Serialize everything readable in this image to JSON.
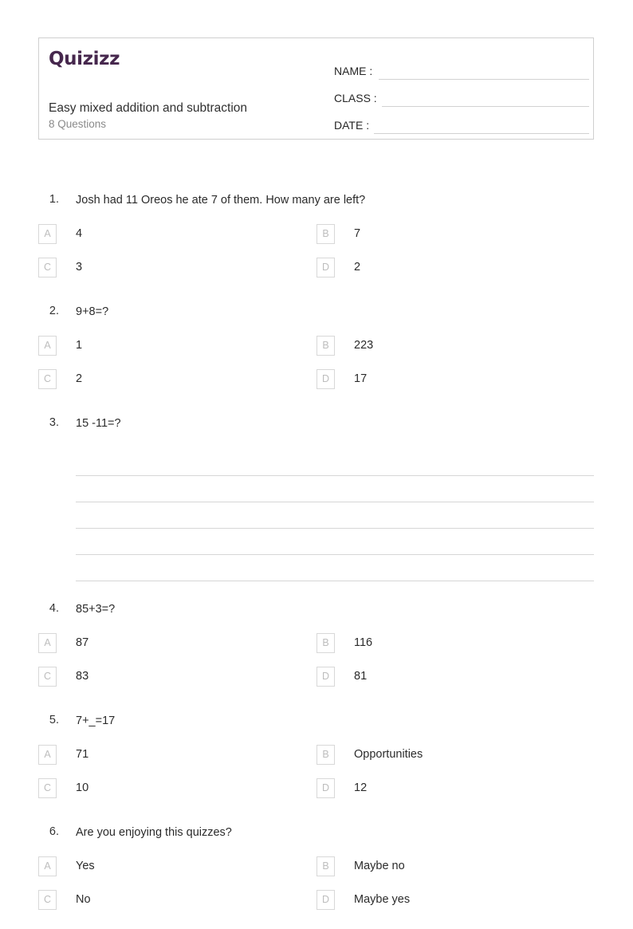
{
  "header": {
    "logo_text": "Quizizz",
    "title": "Easy mixed addition and subtraction",
    "subtitle": "8 Questions",
    "fields": [
      {
        "label": "NAME :"
      },
      {
        "label": "CLASS :"
      },
      {
        "label": "DATE  :"
      }
    ]
  },
  "questions": [
    {
      "number": "1.",
      "text": "Josh had 11 Oreos he ate 7 of them. How many are left?",
      "type": "multiple-choice",
      "options": [
        {
          "letter": "A",
          "text": "4"
        },
        {
          "letter": "B",
          "text": "7"
        },
        {
          "letter": "C",
          "text": "3"
        },
        {
          "letter": "D",
          "text": "2"
        }
      ]
    },
    {
      "number": "2.",
      "text": "9+8=?",
      "type": "multiple-choice",
      "options": [
        {
          "letter": "A",
          "text": "1"
        },
        {
          "letter": "B",
          "text": "223"
        },
        {
          "letter": "C",
          "text": "2"
        },
        {
          "letter": "D",
          "text": "17"
        }
      ]
    },
    {
      "number": "3.",
      "text": "15 -11=?",
      "type": "open-response",
      "line_count": 5
    },
    {
      "number": "4.",
      "text": "85+3=?",
      "type": "multiple-choice",
      "options": [
        {
          "letter": "A",
          "text": "87"
        },
        {
          "letter": "B",
          "text": "116"
        },
        {
          "letter": "C",
          "text": "83"
        },
        {
          "letter": "D",
          "text": "81"
        }
      ]
    },
    {
      "number": "5.",
      "text": "7+_=17",
      "type": "multiple-choice",
      "options": [
        {
          "letter": "A",
          "text": "71"
        },
        {
          "letter": "B",
          "text": "Opportunities"
        },
        {
          "letter": "C",
          "text": "10"
        },
        {
          "letter": "D",
          "text": "12"
        }
      ]
    },
    {
      "number": "6.",
      "text": "Are you enjoying this quizzes?",
      "type": "multiple-choice",
      "options": [
        {
          "letter": "A",
          "text": "Yes"
        },
        {
          "letter": "B",
          "text": "Maybe no"
        },
        {
          "letter": "C",
          "text": "No"
        },
        {
          "letter": "D",
          "text": "Maybe yes"
        }
      ]
    }
  ]
}
